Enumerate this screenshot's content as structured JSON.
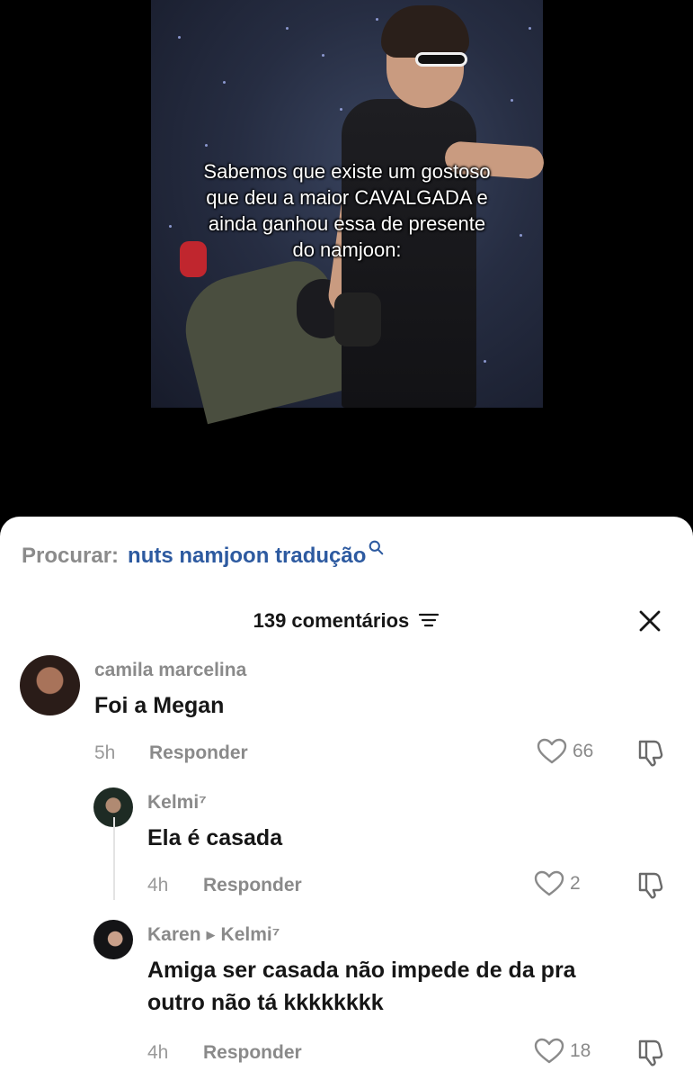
{
  "video": {
    "caption_lines": [
      "Sabemos que existe um gostoso",
      "que deu a maior CAVALGADA e",
      "ainda ganhou essa de presente",
      "do namjoon:"
    ]
  },
  "search": {
    "prefix": "Procurar:",
    "query": "nuts namjoon tradução",
    "icon": "search-icon"
  },
  "header": {
    "count_label": "139 comentários",
    "sort_icon": "sort-icon",
    "close_icon": "close-icon"
  },
  "comments": [
    {
      "username": "camila marcelina",
      "text": "Foi a Megan",
      "time": "5h",
      "reply_label": "Responder",
      "likes": "66"
    },
    {
      "username": "Kelmi⁷",
      "text": "Ela é casada",
      "time": "4h",
      "reply_label": "Responder",
      "likes": "2"
    },
    {
      "username": "Karen",
      "reply_to": "Kelmi⁷",
      "text_line1": "Amiga ser casada não impede de da pra",
      "text_line2": "outro não tá kkkkkkkk",
      "time": "4h",
      "reply_label": "Responder",
      "likes": "18"
    }
  ],
  "colors": {
    "link_blue": "#2d5aa0",
    "muted_gray": "#8a8a8a",
    "text_dark": "#161616"
  }
}
